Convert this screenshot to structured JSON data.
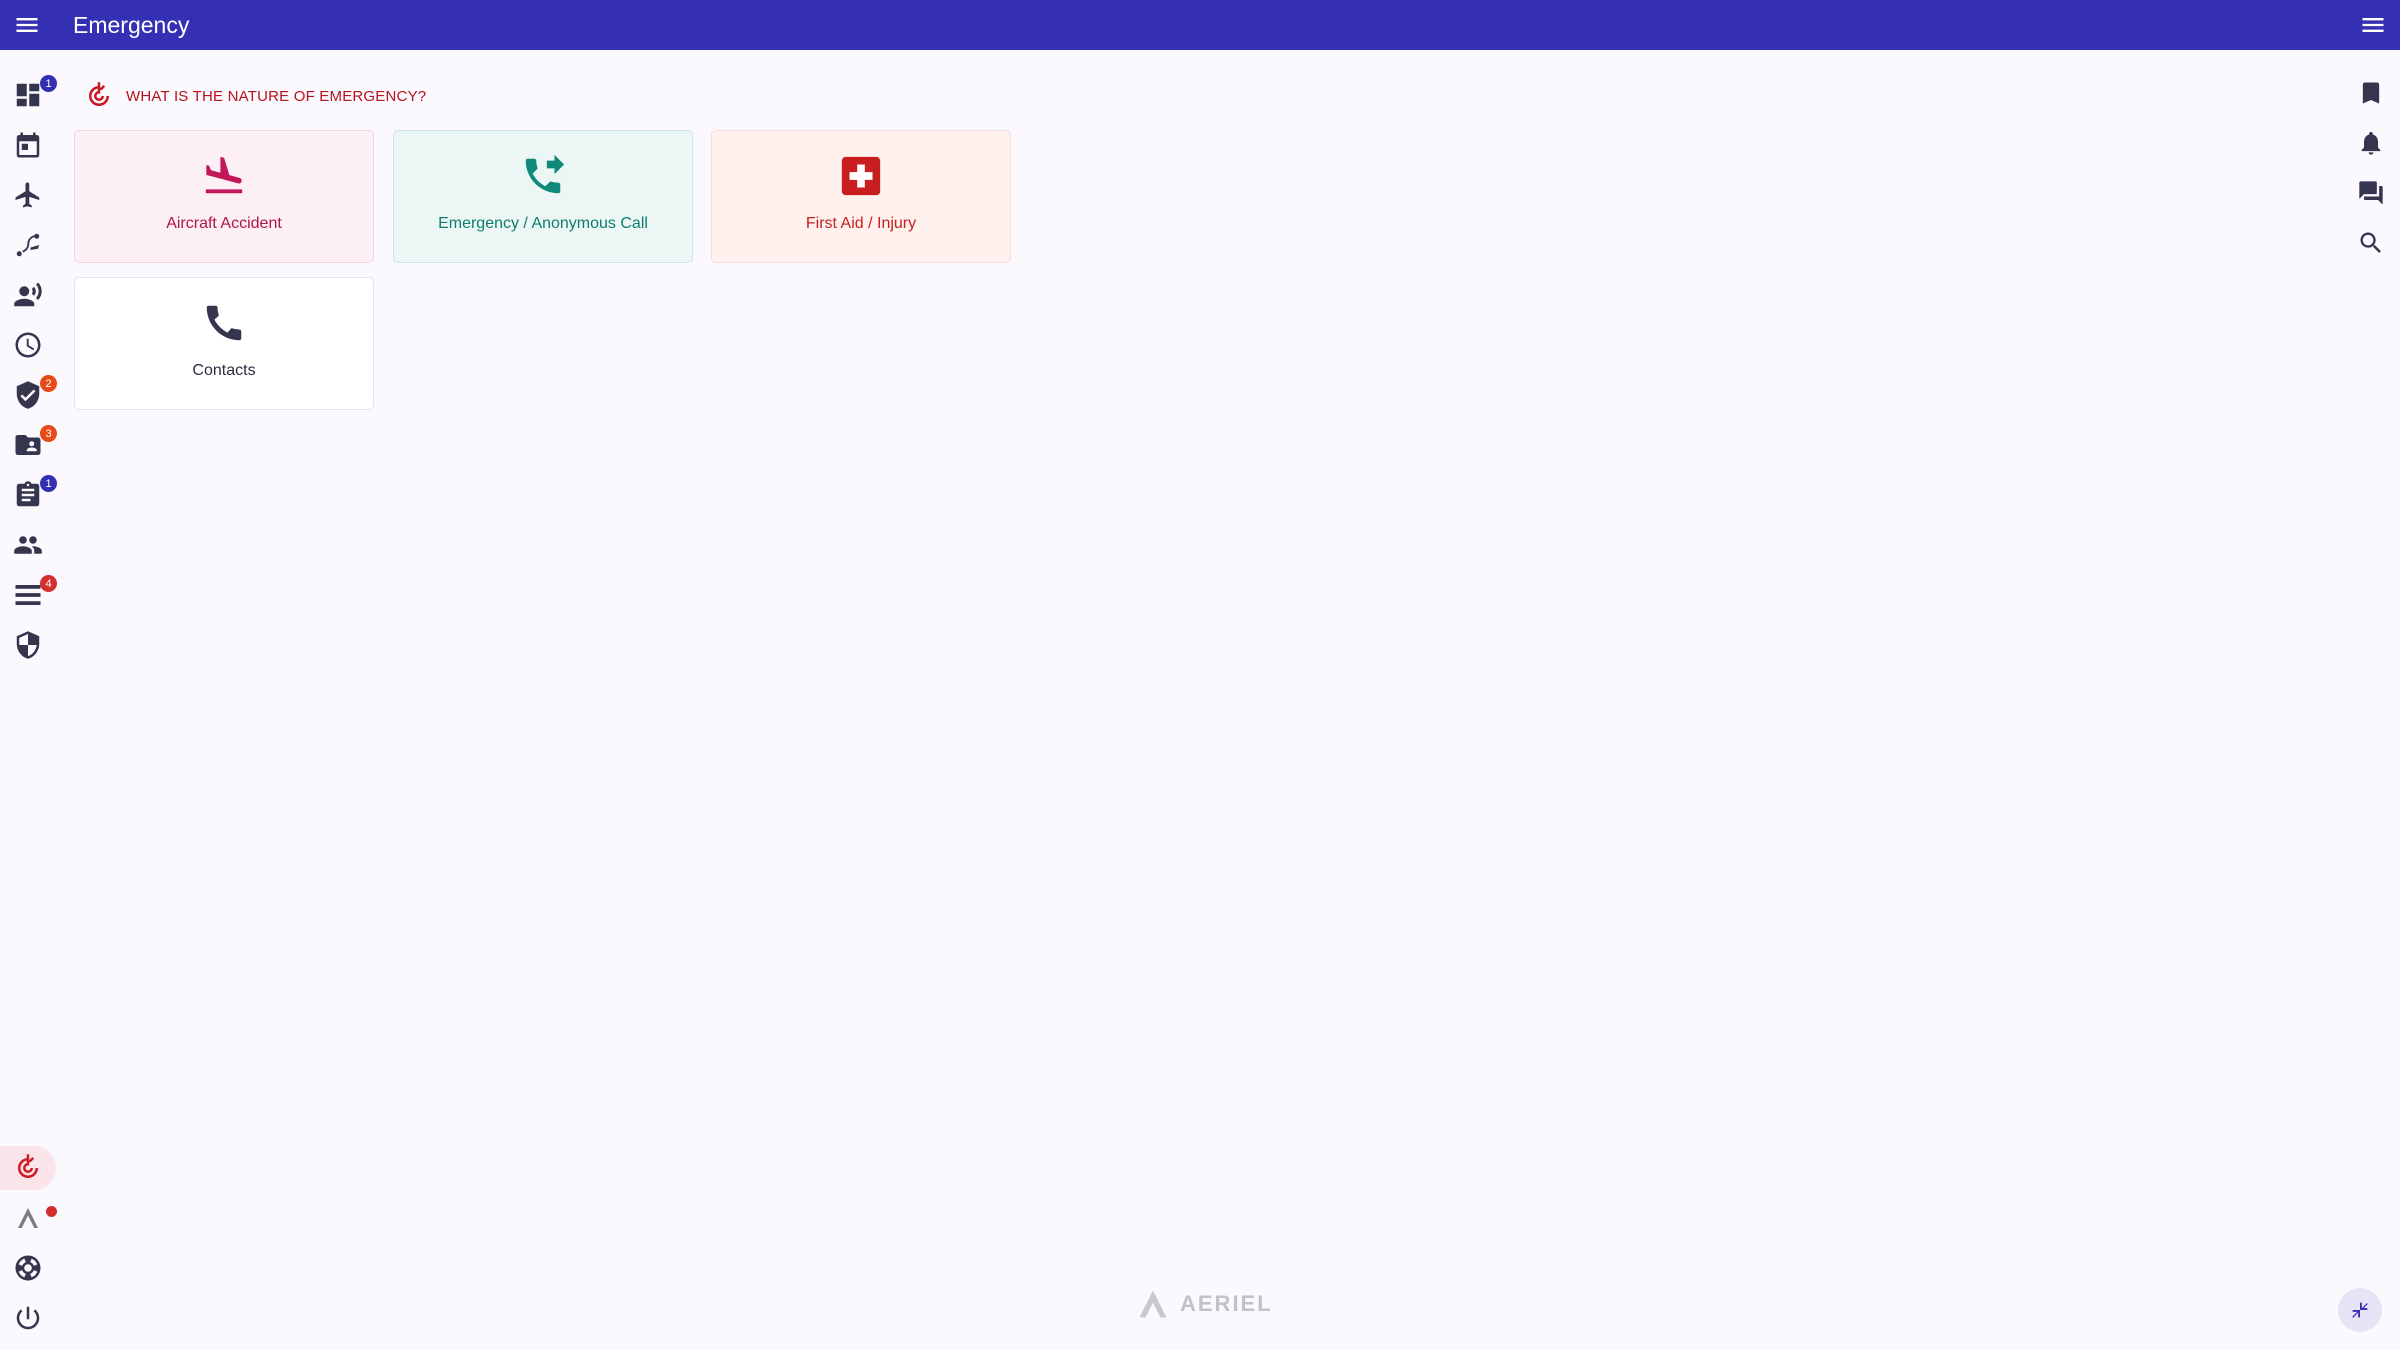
{
  "app": {
    "title": "Emergency"
  },
  "topbar": {
    "menu_icon": "menu-icon",
    "right_menu_icon": "menu-icon"
  },
  "left_rail": {
    "items": [
      {
        "icon": "dashboard-icon",
        "badge": "1",
        "badge_color": "#3530b3"
      },
      {
        "icon": "calendar-icon",
        "badge": ""
      },
      {
        "icon": "airplane-icon",
        "badge": ""
      },
      {
        "icon": "flight-route-icon",
        "badge": ""
      },
      {
        "icon": "announcement-person-icon",
        "badge": ""
      },
      {
        "icon": "clock-icon",
        "badge": ""
      },
      {
        "icon": "verified-shield-icon",
        "badge": "2",
        "badge_color": "#e64a19"
      },
      {
        "icon": "folder-shared-icon",
        "badge": "3",
        "badge_color": "#e64a19"
      },
      {
        "icon": "clipboard-icon",
        "badge": "1",
        "badge_color": "#3530b3"
      },
      {
        "icon": "people-icon",
        "badge": ""
      },
      {
        "icon": "list-icon",
        "badge": "4",
        "badge_color": "#d32f2f"
      },
      {
        "icon": "security-shield-icon",
        "badge": ""
      }
    ],
    "bottom_items": [
      {
        "icon": "emergency-icon",
        "active": true
      },
      {
        "icon": "aeriel-icon",
        "badge_dot_color": "#d32f2f"
      },
      {
        "icon": "support-lifebuoy-icon"
      },
      {
        "icon": "power-icon"
      }
    ]
  },
  "right_rail": {
    "items": [
      "bookmark-icon",
      "bell-icon",
      "chat-icon",
      "search-icon"
    ]
  },
  "main": {
    "question": "WHAT IS THE NATURE OF EMERGENCY?",
    "cards": [
      {
        "id": "aircraft",
        "label": "Aircraft Accident",
        "icon": "flight-land-icon",
        "accent": "#c2185b"
      },
      {
        "id": "anon",
        "label": "Emergency / Anonymous Call",
        "icon": "phone-forwarded-icon",
        "accent": "#0f8a7a"
      },
      {
        "id": "firstaid",
        "label": "First Aid / Injury",
        "icon": "first-aid-icon",
        "accent": "#c81e1e"
      },
      {
        "id": "contacts",
        "label": "Contacts",
        "icon": "phone-icon",
        "accent": "#35364d"
      }
    ]
  },
  "footer": {
    "logo_text": "AERIEL"
  },
  "fab": {
    "icon": "collapse-arrows-icon"
  }
}
